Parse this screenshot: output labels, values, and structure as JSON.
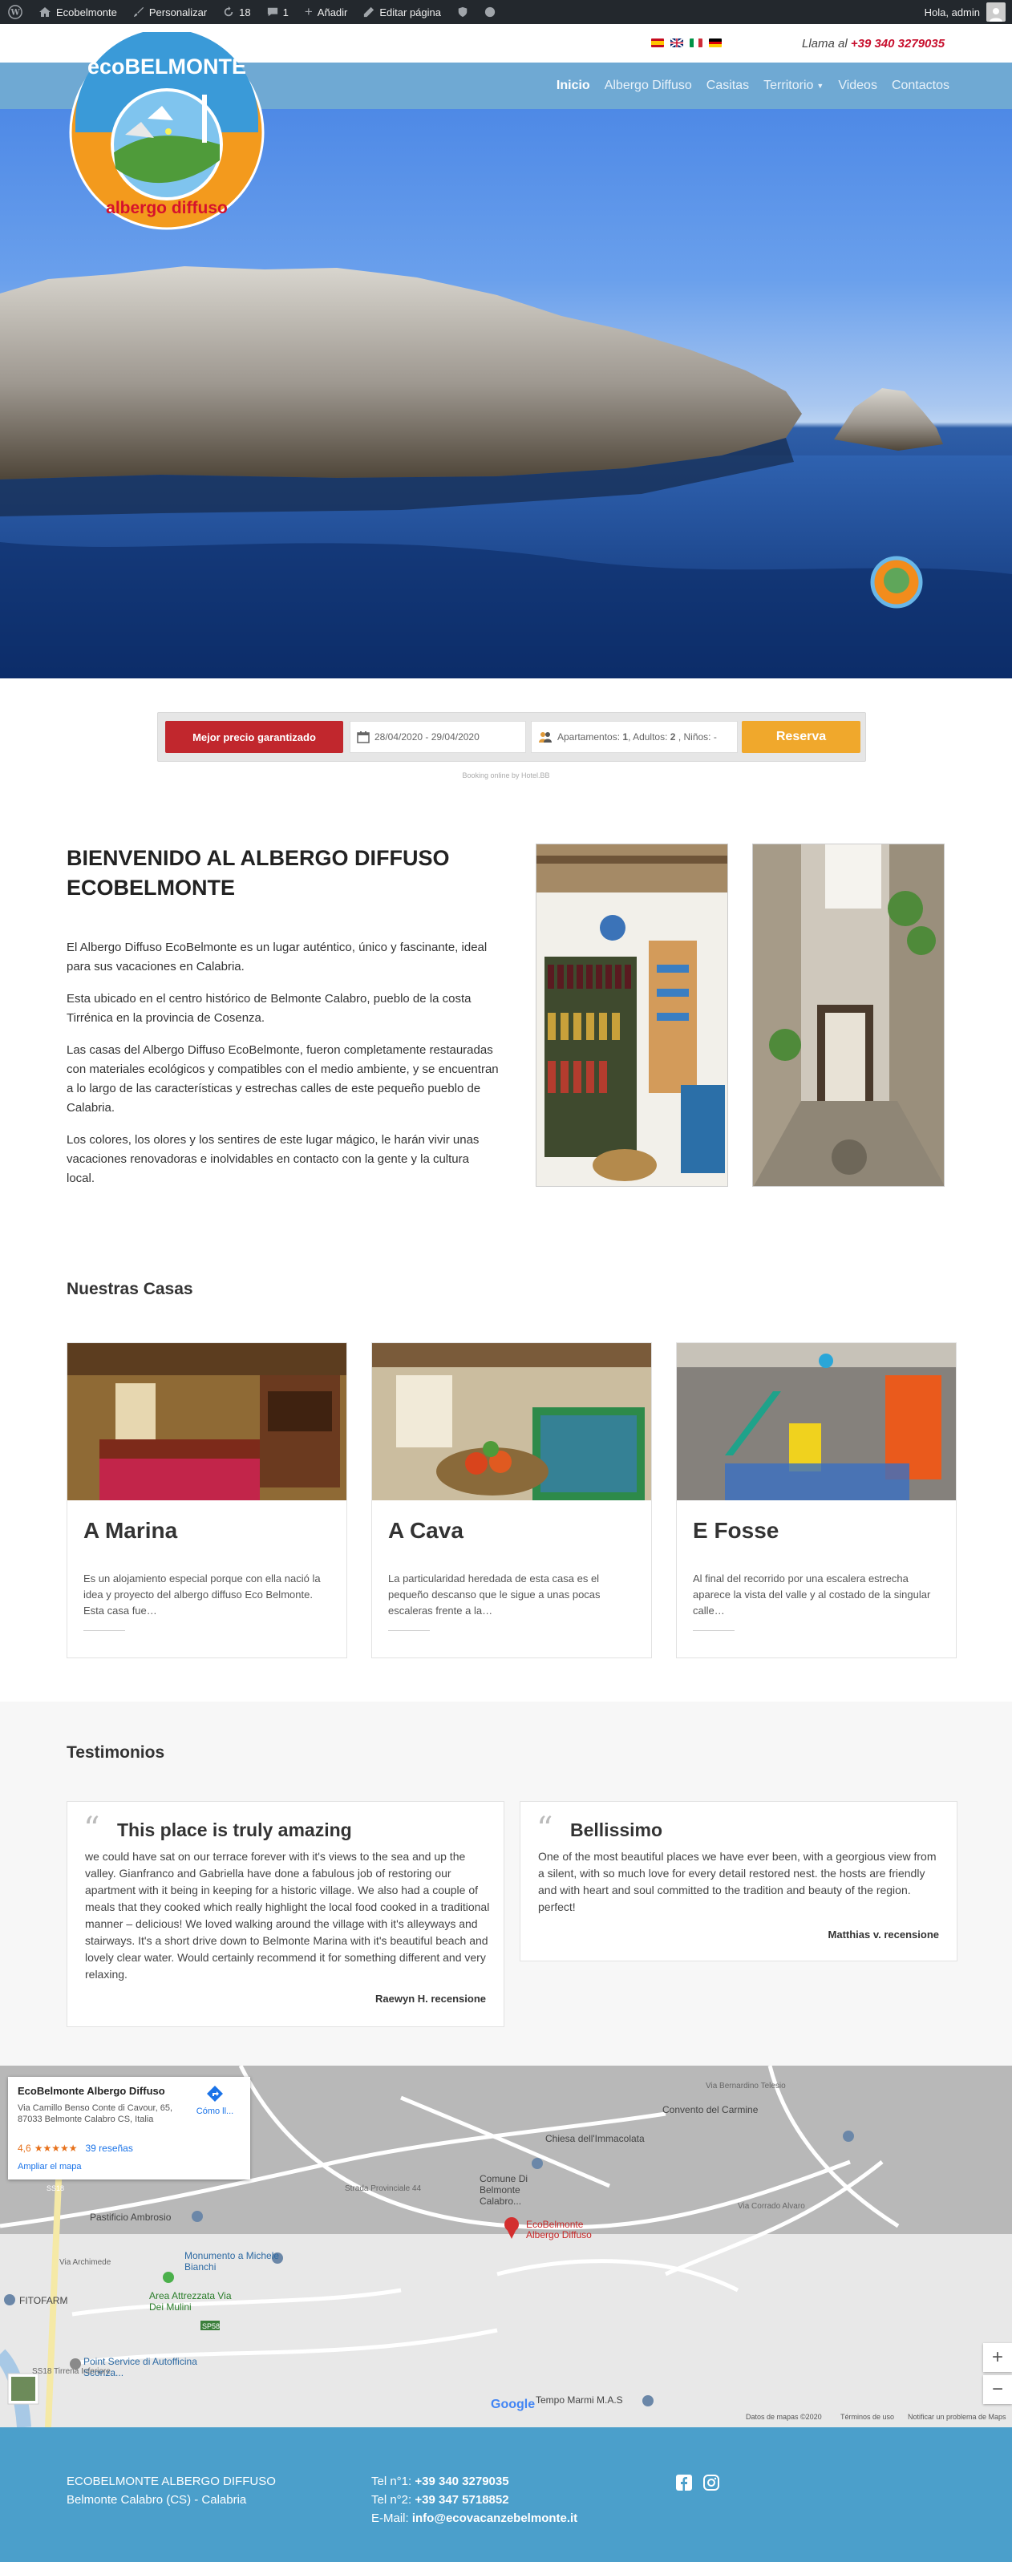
{
  "admin_bar": {
    "site": "Ecobelmonte",
    "customize": "Personalizar",
    "updates": "18",
    "comments": "1",
    "add": "Añadir",
    "edit": "Editar página",
    "greeting": "Hola, admin"
  },
  "topbar": {
    "call_label": "Llama al",
    "phone": "+39 340 3279035"
  },
  "logo": {
    "text_top": "ecoBELMONTE",
    "text_bottom": "albergo diffuso"
  },
  "nav": {
    "items": [
      {
        "label": "Inicio"
      },
      {
        "label": "Albergo Diffuso"
      },
      {
        "label": "Casitas"
      },
      {
        "label": "Territorio"
      },
      {
        "label": "Videos"
      },
      {
        "label": "Contactos"
      }
    ]
  },
  "booking": {
    "best_price": "Mejor precio garantizado",
    "dates": "28/04/2020 - 29/04/2020",
    "guests_label": "Apartamentos:",
    "guests_apts": "1",
    "guests_adults_label": ", Adultos:",
    "guests_adults": "2",
    "guests_kids_label": ", Niños: -",
    "button": "Reserva",
    "powered": "Booking online by Hotel.BB"
  },
  "welcome": {
    "title": "BIENVENIDO AL ALBERGO DIFFUSO ECOBELMONTE",
    "paragraphs": [
      "El Albergo Diffuso EcoBelmonte es un lugar auténtico, único y fascinante, ideal para sus vacaciones en Calabria.",
      "Esta ubicado en el centro histórico de Belmonte Calabro, pueblo de la costa Tirrénica en la provincia de Cosenza.",
      "Las casas del Albergo Diffuso EcoBelmonte, fueron completamente restauradas con materiales ecológicos y compatibles con el medio ambiente, y se encuentran a lo largo de las características y estrechas calles de este pequeño pueblo de Calabria.",
      "Los colores, los olores y los sentires de este lugar mágico, le harán vivir unas vacaciones renovadoras e inolvidables en contacto con la gente y la cultura local."
    ]
  },
  "houses": {
    "title": "Nuestras Casas",
    "items": [
      {
        "name": "A Marina",
        "text": "Es un alojamiento especial porque con ella nació la idea y proyecto del albergo diffuso Eco Belmonte. Esta casa fue…"
      },
      {
        "name": "A Cava",
        "text": "La particularidad heredada de esta casa es el pequeño descanso que le sigue a unas pocas  escaleras frente a la…"
      },
      {
        "name": "E Fosse",
        "text": "Al final del recorrido por una escalera estrecha aparece la vista del valle y al costado de la singular calle…"
      }
    ]
  },
  "testimonials": {
    "title": "Testimonios",
    "items": [
      {
        "title": "This place is truly amazing",
        "text": "we could have sat on our terrace forever with it's views to the sea and up the valley. Gianfranco and Gabriella have done a fabulous job of restoring our apartment with it being in keeping for a historic village. We also had a couple of meals that they cooked which really highlight the local food cooked in a traditional manner – delicious! We loved walking around the village with it's alleyways and stairways. It's a short drive down to Belmonte Marina with it's beautiful beach and lovely clear water. Would certainly recommend it for something different and very relaxing.",
        "author": "Raewyn H. recensione"
      },
      {
        "title": "Bellissimo",
        "text": "One of the most beautiful places we have ever been, with a georgious view from a silent, with so much love for every detail restored nest. the hosts are friendly and with heart and soul committed to the tradition and beauty of the region. perfect!",
        "author": "Matthias v. recensione"
      }
    ]
  },
  "map": {
    "place_name": "EcoBelmonte Albergo Diffuso",
    "address": "Via Camillo Benso Conte di Cavour, 65, 87033 Belmonte Calabro CS, Italia",
    "rating": "4,6",
    "stars": "★★★★★",
    "reviews": "39 reseñas",
    "directions": "Cómo ll...",
    "enlarge": "Ampliar el mapa",
    "pin_label": "EcoBelmonte Albergo Diffuso",
    "labels": [
      "Chiesa dell'Immacolata",
      "Convento del Carmine",
      "Comune Di Belmonte Calabro...",
      "Pastificio Ambrosio",
      "Monumento a Michele Bianchi",
      "Area Attrezzata Via Dei Mulini",
      "FITOFARM",
      "Point Service di Autofficina Sconza...",
      "Tempo Marmi M.A.S",
      "Via Bernardino Telesio",
      "Strada Provinciale 44",
      "Via Archimede",
      "SS18 Tirrena Inferiore",
      "SS18",
      "SP58",
      "Via Corrado Alvaro"
    ],
    "attribution": "Datos de mapas ©2020",
    "terms": "Términos de uso",
    "report": "Notificar un problema de Maps",
    "google": "Google",
    "zoom_in": "+",
    "zoom_out": "−"
  },
  "footer": {
    "name": "ECOBELMONTE ALBERGO DIFFUSO",
    "location": "Belmonte Calabro (CS) - Calabria",
    "tel1_label": "Tel n°1: ",
    "tel1": "+39 340 3279035",
    "tel2_label": "Tel n°2: ",
    "tel2": "+39 347 5718852",
    "email_label": "E-Mail: ",
    "email": "info@ecovacanzebelmonte.it"
  },
  "colors": {
    "nav": "#6fa9d3",
    "footer": "#4b9fcb",
    "accent_red": "#c1272d",
    "accent_orange": "#f0a82c"
  }
}
